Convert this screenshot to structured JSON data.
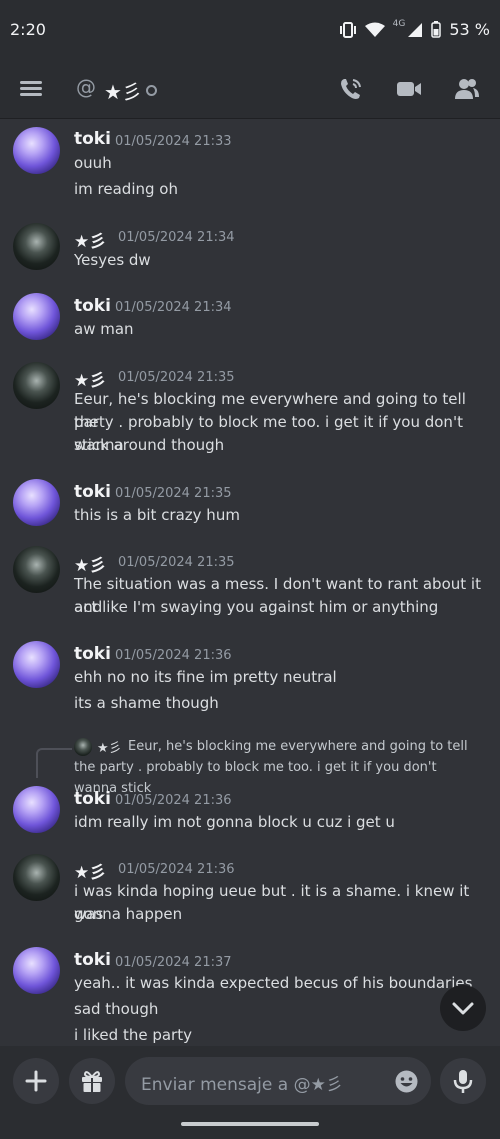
{
  "status_bar": {
    "time": "2:20",
    "network": "4G",
    "battery": "53 %"
  },
  "header": {
    "at_symbol": "@",
    "channel_name": "★彡"
  },
  "messages": [
    {
      "author": "toki",
      "timestamp": "01/05/2024 21:33",
      "lines": [
        "ouuh",
        "im reading oh"
      ]
    },
    {
      "author": "★彡",
      "timestamp": "01/05/2024 21:34",
      "lines": [
        "Yesyes dw"
      ]
    },
    {
      "author": "toki",
      "timestamp": "01/05/2024 21:34",
      "lines": [
        "aw man"
      ]
    },
    {
      "author": "★彡",
      "timestamp": "01/05/2024 21:35",
      "lines": [
        "Eeur, he's blocking me everywhere and going to tell the",
        "party . probably to block me too. i get it if you don't wanna",
        "stick around though"
      ]
    },
    {
      "author": "toki",
      "timestamp": "01/05/2024 21:35",
      "lines": [
        "this is a bit crazy hum"
      ]
    },
    {
      "author": "★彡",
      "timestamp": "01/05/2024 21:35",
      "lines": [
        "The situation was a mess. I don't want to rant about it and",
        "act like I'm swaying you against him or anything"
      ]
    },
    {
      "author": "toki",
      "timestamp": "01/05/2024 21:36",
      "lines": [
        "ehh no no its fine im pretty neutral",
        "its a shame though"
      ]
    },
    {
      "author": "toki",
      "timestamp": "01/05/2024 21:36",
      "lines": [
        "idm really im not gonna block u cuz i get u"
      ]
    },
    {
      "author": "★彡",
      "timestamp": "01/05/2024 21:36",
      "lines": [
        "i was kinda hoping ueue but . it is a shame. i knew it was",
        "gonna happen"
      ]
    },
    {
      "author": "toki",
      "timestamp": "01/05/2024 21:37",
      "lines": [
        "yeah.. it was kinda expected becus of his boundaries",
        "sad though",
        "i liked the party"
      ]
    }
  ],
  "reply_preview": {
    "author": "★彡",
    "text": "Eeur, he's blocking me everywhere and going to tell the party . probably to block me too. i get it if you don't wanna stick"
  },
  "composer": {
    "placeholder": "Enviar mensaje a @★彡"
  },
  "colors": {
    "background": "#313338",
    "bar": "#2b2d31",
    "input": "#383a40",
    "muted": "#949ba4",
    "text": "#dbdee1"
  }
}
